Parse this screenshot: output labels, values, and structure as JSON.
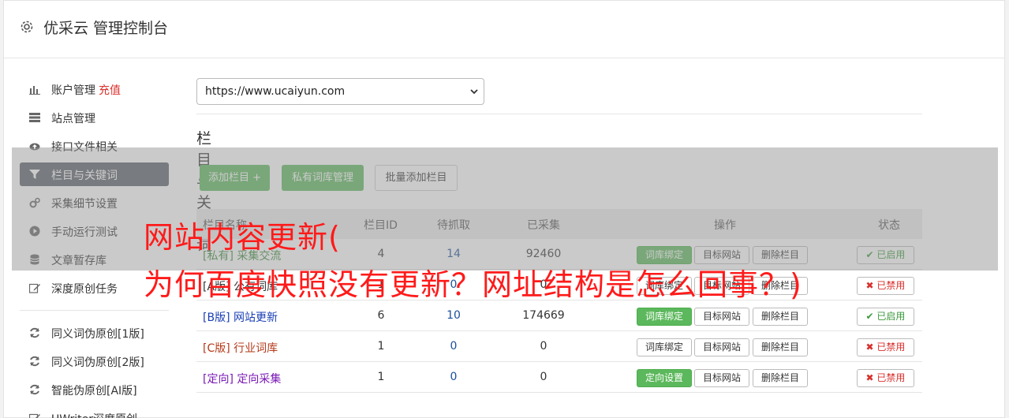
{
  "header": {
    "title": "优采云 管理控制台"
  },
  "sidebar": {
    "items": [
      {
        "label": "账户管理",
        "extra": "充值",
        "icon": "bar-chart-icon"
      },
      {
        "label": "站点管理",
        "icon": "server-icon"
      },
      {
        "label": "接口文件相关",
        "icon": "cloud-upload-icon"
      },
      {
        "label": "栏目与关键词",
        "icon": "filter-icon",
        "active": true
      },
      {
        "label": "采集细节设置",
        "icon": "gears-icon"
      },
      {
        "label": "手动运行测试",
        "icon": "play-circle-icon"
      },
      {
        "label": "文章暂存库",
        "icon": "database-icon"
      },
      {
        "label": "深度原创任务",
        "icon": "edit-icon"
      },
      {
        "label": "同义词伪原创[1版]",
        "icon": "refresh-icon"
      },
      {
        "label": "同义词伪原创[2版]",
        "icon": "refresh-icon"
      },
      {
        "label": "智能伪原创[AI版]",
        "icon": "refresh-icon"
      },
      {
        "label": "UWriter深度原创",
        "icon": "edit-icon"
      }
    ]
  },
  "main": {
    "site_select": {
      "value": "https://www.ucaiyun.com"
    },
    "section_title": "栏目与关键词",
    "buttons": {
      "add_column": "添加栏目 +",
      "private_lib": "私有词库管理",
      "batch_add": "批量添加栏目"
    }
  },
  "table": {
    "headers": {
      "name": "栏目名称",
      "id": "栏目ID",
      "pending": "待抓取",
      "collected": "已采集",
      "ops": "操作",
      "status": "状态"
    },
    "rows": [
      {
        "tag": "[私有]",
        "name": "采集交流",
        "id": "4",
        "pending": "14",
        "collected": "92460",
        "op1": "词库绑定",
        "op2": "目标网站",
        "op3": "删除栏目",
        "status": "已启用",
        "color": "#3c8a3c"
      },
      {
        "tag": "[A版]",
        "name": "公有词库",
        "id": "1",
        "pending": "0",
        "collected": "0",
        "op1": "词库绑定",
        "op2": "目标网站",
        "op3": "删除栏目",
        "status": "已禁用",
        "color": "#333333"
      },
      {
        "tag": "[B版]",
        "name": "网站更新",
        "id": "6",
        "pending": "10",
        "collected": "174669",
        "op1": "词库绑定",
        "op2": "目标网站",
        "op3": "删除栏目",
        "status": "已启用",
        "color": "#1a3fb5"
      },
      {
        "tag": "[C版]",
        "name": "行业词库",
        "id": "1",
        "pending": "0",
        "collected": "0",
        "op1": "词库绑定",
        "op2": "目标网站",
        "op3": "删除栏目",
        "status": "已禁用",
        "color": "#b53a1a"
      },
      {
        "tag": "[定向]",
        "name": "定向采集",
        "id": "1",
        "pending": "0",
        "collected": "0",
        "op1": "定向设置",
        "op2": "目标网站",
        "op3": "删除栏目",
        "status": "已禁用",
        "color": "#7a1ab5"
      }
    ]
  },
  "overlay": {
    "line1": "网站内容更新(",
    "line2": "为何百度快照没有更新？网址结构是怎么回事？)"
  }
}
